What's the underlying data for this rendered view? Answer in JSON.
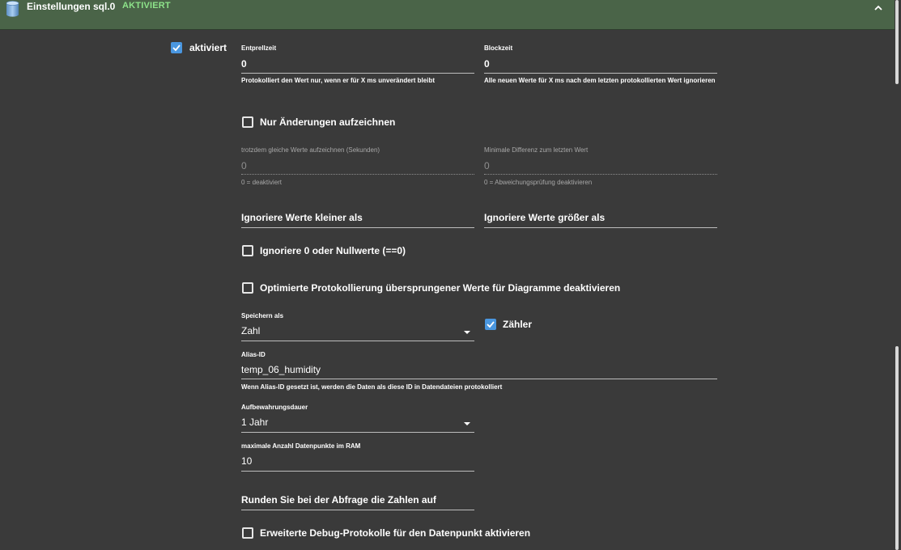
{
  "header": {
    "title": "Einstellungen sql.0",
    "status": "AKTIVIERT",
    "icon": "database-icon",
    "collapse_icon": "chevron-up-icon"
  },
  "enabled": {
    "label": "aktiviert",
    "checked": true
  },
  "debounce": {
    "label": "Entprellzeit",
    "value": "0",
    "helper": "Protokolliert den Wert nur, wenn er für X ms unverändert bleibt"
  },
  "blocktime": {
    "label": "Blockzeit",
    "value": "0",
    "helper": "Alle neuen Werte für X ms nach dem letzten protokollierten Wert ignorieren"
  },
  "only_changes": {
    "label": "Nur Änderungen aufzeichnen",
    "checked": false
  },
  "same_values": {
    "label": "trotzdem gleiche Werte aufzeichnen (Sekunden)",
    "value": "0",
    "helper": "0 = deaktiviert"
  },
  "min_diff": {
    "label": "Minimale Differenz zum letzten Wert",
    "value": "0",
    "helper": "0 = Abweichungsprüfung deaktivieren"
  },
  "ignore_below": {
    "placeholder": "Ignoriere Werte kleiner als"
  },
  "ignore_above": {
    "placeholder": "Ignoriere Werte größer als"
  },
  "ignore_zero": {
    "label": "Ignoriere 0 oder Nullwerte (==0)",
    "checked": false
  },
  "disable_skipped": {
    "label": "Optimierte Protokollierung übersprungener Werte für Diagramme deaktivieren",
    "checked": false
  },
  "store_as": {
    "label": "Speichern als",
    "value": "Zahl"
  },
  "counter": {
    "label": "Zähler",
    "checked": true
  },
  "alias": {
    "label": "Alias-ID",
    "value": "temp_06_humidity",
    "helper": "Wenn Alias-ID gesetzt ist, werden die Daten als diese ID in Datendateien protokolliert"
  },
  "retention": {
    "label": "Aufbewahrungsdauer",
    "value": "1 Jahr"
  },
  "max_points": {
    "label": "maximale Anzahl Datenpunkte im RAM",
    "value": "10"
  },
  "round": {
    "placeholder": "Runden Sie bei der Abfrage die Zahlen auf"
  },
  "debug": {
    "label": "Erweiterte Debug-Protokolle für den Datenpunkt aktivieren",
    "checked": false
  }
}
